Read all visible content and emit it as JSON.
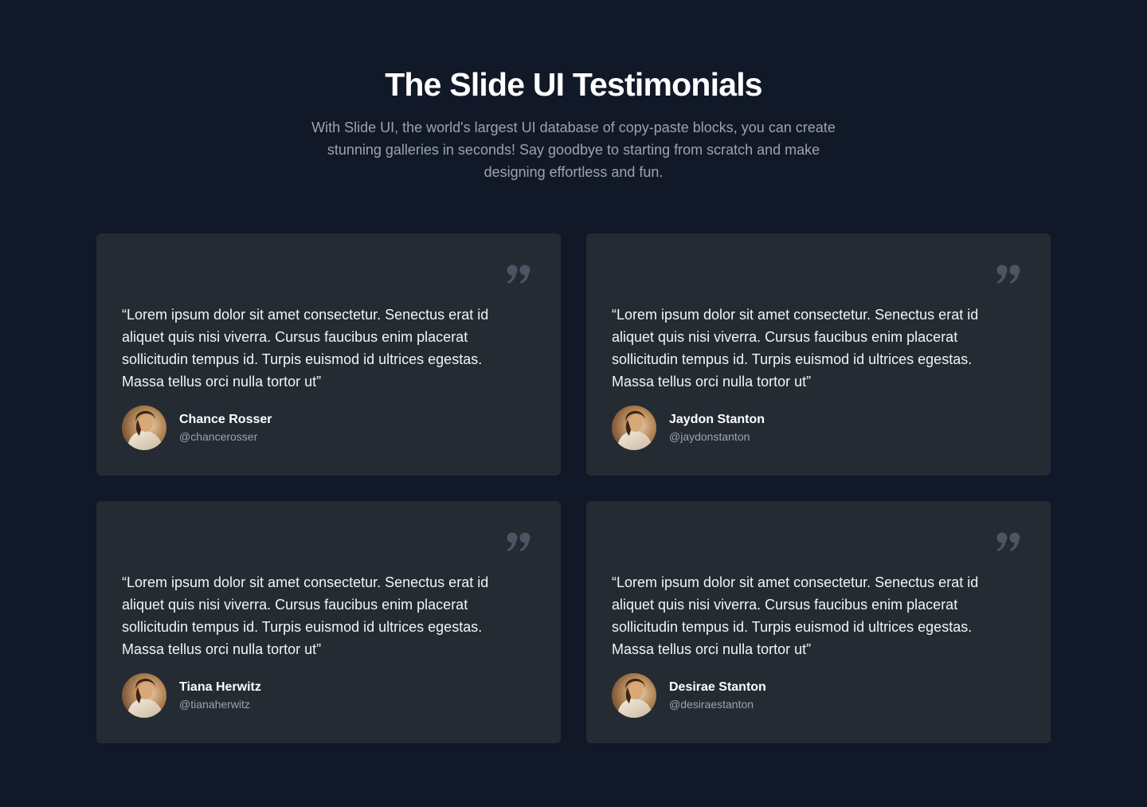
{
  "header": {
    "title": "The Slide UI Testimonials",
    "subtitle": "With Slide UI, the world's largest UI database of copy-paste blocks, you can create stunning galleries in seconds! Say goodbye to starting from scratch and make designing effortless and fun."
  },
  "icons": {
    "quote": "quote-icon",
    "avatar": "avatar-photo"
  },
  "colors": {
    "background": "#111827",
    "card": "#252b33",
    "quote_icon": "#4b5563",
    "subtitle": "#9ca3af"
  },
  "testimonials": [
    {
      "quote": "“Lorem ipsum dolor sit amet consectetur. Senectus erat id aliquet quis nisi viverra. Cursus faucibus enim placerat sollicitudin tempus id. Turpis euismod id ultrices egestas. Massa tellus orci nulla tortor ut”",
      "name": "Chance Rosser",
      "handle": "@chancerosser"
    },
    {
      "quote": "“Lorem ipsum dolor sit amet consectetur. Senectus erat id aliquet quis nisi viverra. Cursus faucibus enim placerat sollicitudin tempus id. Turpis euismod id ultrices egestas. Massa tellus orci nulla tortor ut”",
      "name": "Jaydon Stanton",
      "handle": "@jaydonstanton"
    },
    {
      "quote": "“Lorem ipsum dolor sit amet consectetur. Senectus erat id aliquet quis nisi viverra. Cursus faucibus enim placerat sollicitudin tempus id. Turpis euismod id ultrices egestas. Massa tellus orci nulla tortor ut”",
      "name": "Tiana Herwitz",
      "handle": "@tianaherwitz"
    },
    {
      "quote": "“Lorem ipsum dolor sit amet consectetur. Senectus erat id aliquet quis nisi viverra. Cursus faucibus enim placerat sollicitudin tempus id. Turpis euismod id ultrices egestas. Massa tellus orci nulla tortor ut”",
      "name": "Desirae Stanton",
      "handle": "@desiraestanton"
    }
  ]
}
